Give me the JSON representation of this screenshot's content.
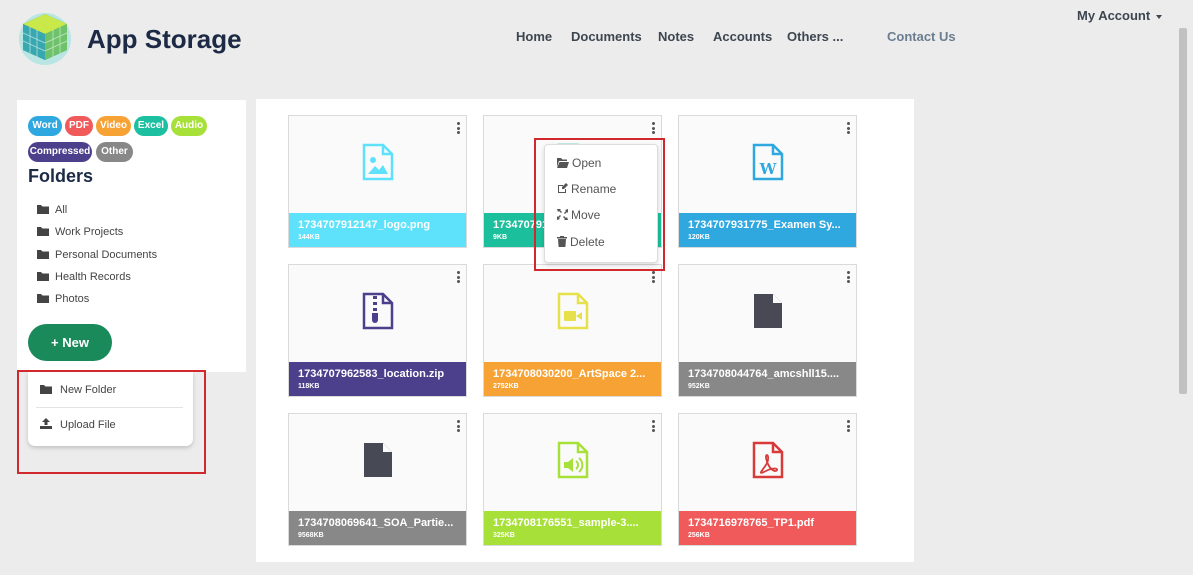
{
  "header": {
    "brand": "App Storage",
    "nav": [
      "Home",
      "Documents",
      "Notes",
      "Accounts",
      "Others ...",
      "Contact Us"
    ],
    "account": "My Account"
  },
  "sidebar": {
    "tags": [
      {
        "label": "Word",
        "color": "#2fa8e0"
      },
      {
        "label": "PDF",
        "color": "#f05a5b"
      },
      {
        "label": "Video",
        "color": "#f7a234"
      },
      {
        "label": "Excel",
        "color": "#1cbfa0"
      },
      {
        "label": "Audio",
        "color": "#a8e03a"
      },
      {
        "label": "Compressed",
        "color": "#4c3f8c"
      },
      {
        "label": "Other",
        "color": "#888888"
      }
    ],
    "title": "Folders",
    "folders": [
      "All",
      "Work Projects",
      "Personal Documents",
      "Health Records",
      "Photos"
    ],
    "new_label": "+ New"
  },
  "new_menu": {
    "new_folder": "New Folder",
    "upload_file": "Upload File"
  },
  "files": [
    {
      "name": "1734707912147_logo.png",
      "size": "144KB",
      "color": "#5ee2fb",
      "icon": "image-file-icon"
    },
    {
      "name": "173470791...",
      "size": "9KB",
      "color": "#1cbf9b",
      "icon": "excel-file-icon"
    },
    {
      "name": "1734707931775_Examen Sy...",
      "size": "120KB",
      "color": "#2fa8e0",
      "icon": "word-file-icon"
    },
    {
      "name": "1734707962583_location.zip",
      "size": "118KB",
      "color": "#4c3f8c",
      "icon": "zip-file-icon"
    },
    {
      "name": "1734708030200_ArtSpace 2...",
      "size": "2752KB",
      "color": "#f7a234",
      "icon": "video-file-icon"
    },
    {
      "name": "1734708044764_amcshll15....",
      "size": "952KB",
      "color": "#888888",
      "icon": "generic-file-icon"
    },
    {
      "name": "1734708069641_SOA_Partie...",
      "size": "9568KB",
      "color": "#888888",
      "icon": "generic-file-icon"
    },
    {
      "name": "1734708176551_sample-3....",
      "size": "325KB",
      "color": "#a8e03a",
      "icon": "audio-file-icon"
    },
    {
      "name": "1734716978765_TP1.pdf",
      "size": "256KB",
      "color": "#f05a5b",
      "icon": "pdf-file-icon"
    }
  ],
  "context_menu": {
    "open": "Open",
    "rename": "Rename",
    "move": "Move",
    "delete": "Delete"
  }
}
